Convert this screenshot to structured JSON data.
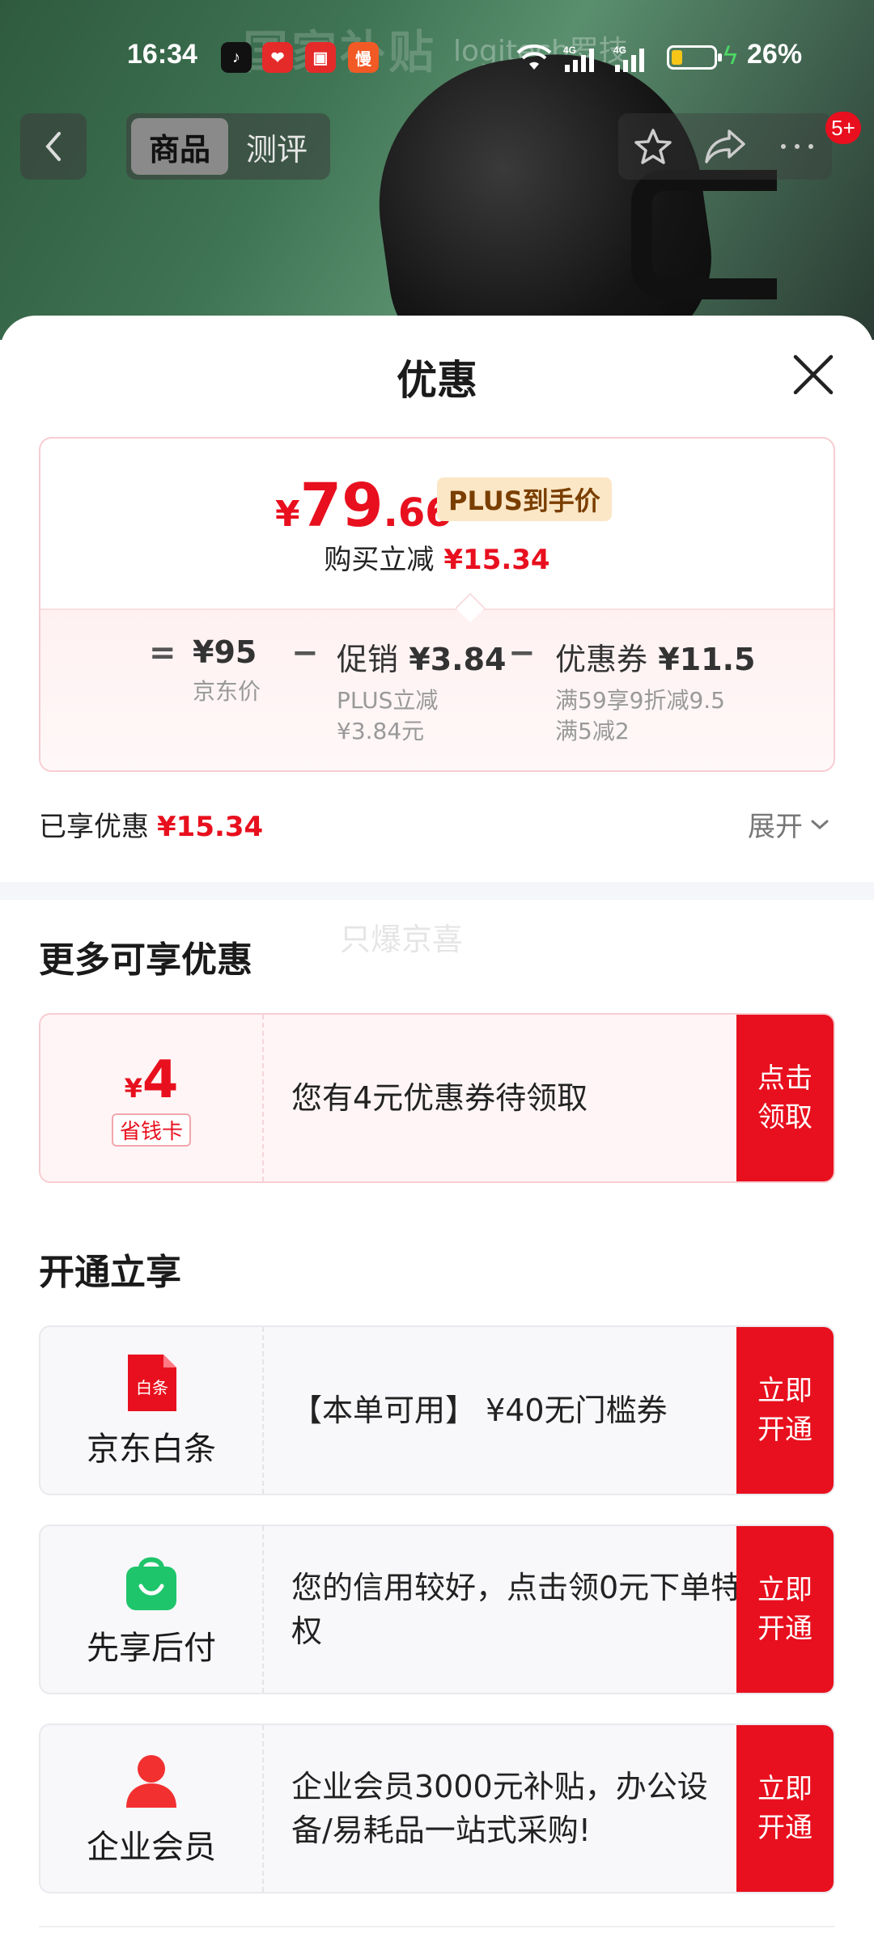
{
  "status_bar": {
    "time": "16:34",
    "battery_pct": "26%",
    "battery_level": 0.26,
    "network_1": "4G",
    "network_2": "4G",
    "app_icons": [
      "tiktok-icon",
      "red-heart-app-icon",
      "red-envelope-app-icon",
      "orange-app-icon"
    ],
    "app_icon_glyph_4": "慢"
  },
  "background": {
    "banner_text": "国家补贴",
    "brand_text": "logitech罗技"
  },
  "nav": {
    "tabs": [
      {
        "label": "商品",
        "active": true
      },
      {
        "label": "测评",
        "active": false
      }
    ],
    "badge": "5+"
  },
  "sheet": {
    "title": "优惠",
    "price": {
      "yen": "¥",
      "integer": "79",
      "decimal": ".66",
      "tag": "PLUS到手价",
      "buy_reduce_label": "购买立减",
      "buy_reduce_value": "¥15.34"
    },
    "calc": {
      "eq": "=",
      "minus": "−",
      "jd_price_value": "¥95",
      "jd_price_label": "京东价",
      "promo_label": "促销",
      "promo_value": "¥3.84",
      "promo_sub_1": "PLUS立减",
      "promo_sub_2": "¥3.84元",
      "coupon_label": "优惠券",
      "coupon_value": "¥11.5",
      "coupon_sub_1": "满59享9折减9.5",
      "coupon_sub_2": "满5减2"
    },
    "enjoyed_label": "已享优惠",
    "enjoyed_value": "¥15.34",
    "expand_label": "展开",
    "watermark": "只爆京喜",
    "more_section_title": "更多可享优惠",
    "coupon_card": {
      "yen": "¥",
      "amount": "4",
      "tag": "省钱卡",
      "text": "您有4元优惠券待领取",
      "button": "点击领取"
    },
    "open_section_title": "开通立享",
    "services": [
      {
        "name": "京东白条",
        "icon_text": "白条",
        "text": "【本单可用】 ¥40无门槛券",
        "button": "立即开通"
      },
      {
        "name": "先享后付",
        "icon_text": "",
        "text": "您的信用较好，点击领0元下单特权",
        "button": "立即开通"
      },
      {
        "name": "企业会员",
        "icon_text": "",
        "text": "企业会员3000元补贴，办公设备/易耗品一站式采购!",
        "button": "立即开通"
      }
    ]
  },
  "colors": {
    "accent_red": "#e8101e",
    "plus_tag_bg": "#fbe7c6",
    "plus_tag_text": "#7a3e00",
    "green_icon": "#1fc56b"
  }
}
